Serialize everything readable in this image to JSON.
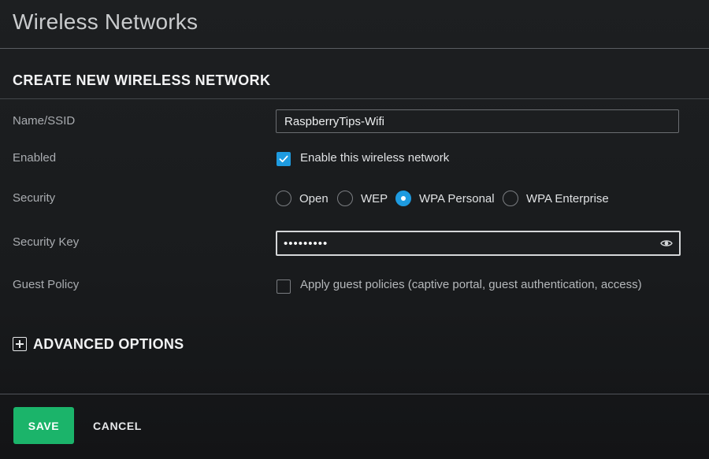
{
  "page": {
    "title": "Wireless Networks"
  },
  "form": {
    "section_title": "CREATE NEW WIRELESS NETWORK",
    "name": {
      "label": "Name/SSID",
      "value": "RaspberryTips-Wifi"
    },
    "enabled": {
      "label": "Enabled",
      "checkbox_text": "Enable this wireless network",
      "checked": true
    },
    "security": {
      "label": "Security",
      "options": [
        {
          "label": "Open",
          "selected": false
        },
        {
          "label": "WEP",
          "selected": false
        },
        {
          "label": "WPA Personal",
          "selected": true
        },
        {
          "label": "WPA Enterprise",
          "selected": false
        }
      ]
    },
    "security_key": {
      "label": "Security Key",
      "masked_value": "•••••••••"
    },
    "guest_policy": {
      "label": "Guest Policy",
      "checkbox_text": "Apply guest policies (captive portal, guest authentication, access)",
      "checked": false
    },
    "advanced": {
      "label": "ADVANCED OPTIONS",
      "icon": "plus-square-icon"
    }
  },
  "actions": {
    "save_label": "SAVE",
    "cancel_label": "CANCEL"
  },
  "colors": {
    "accent": "#1e9be0",
    "save": "#1bb46a",
    "background": "#1a1c1e"
  }
}
